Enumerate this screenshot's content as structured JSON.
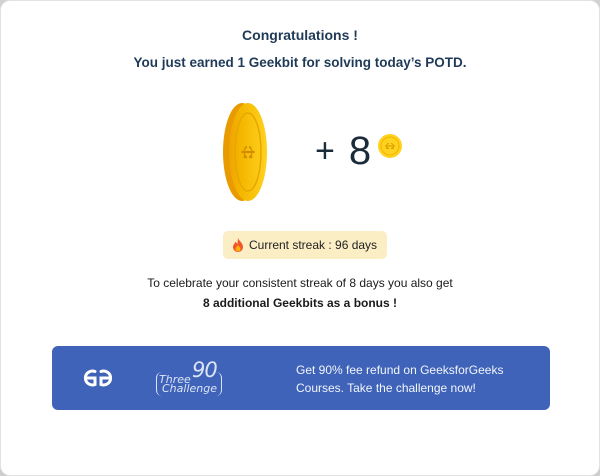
{
  "header": {
    "title": "Congratulations !",
    "subtitle": "You just earned 1 Geekbit for solving today’s POTD."
  },
  "reward": {
    "plus": "+",
    "amount": "8",
    "coin_icon": "gfg-coin-icon"
  },
  "streak": {
    "icon": "fire-icon",
    "label": "Current streak : 96 days"
  },
  "bonus": {
    "line1": "To celebrate your consistent streak of 8 days you also get",
    "line2": "8 additional Geekbits as a bonus !"
  },
  "banner": {
    "logo_icon": "gfg-logo-icon",
    "challenge_three": "Three",
    "challenge_ninety": "90",
    "challenge_word": "Challenge",
    "promo_line1": "Get 90% fee refund on GeeksforGeeks",
    "promo_line2": "Courses. Take the challenge now!"
  },
  "colors": {
    "heading": "#1f3a57",
    "coin_gold": "#f5c518",
    "streak_bg": "#fbeec4",
    "banner_bg": "#3f63b8"
  }
}
